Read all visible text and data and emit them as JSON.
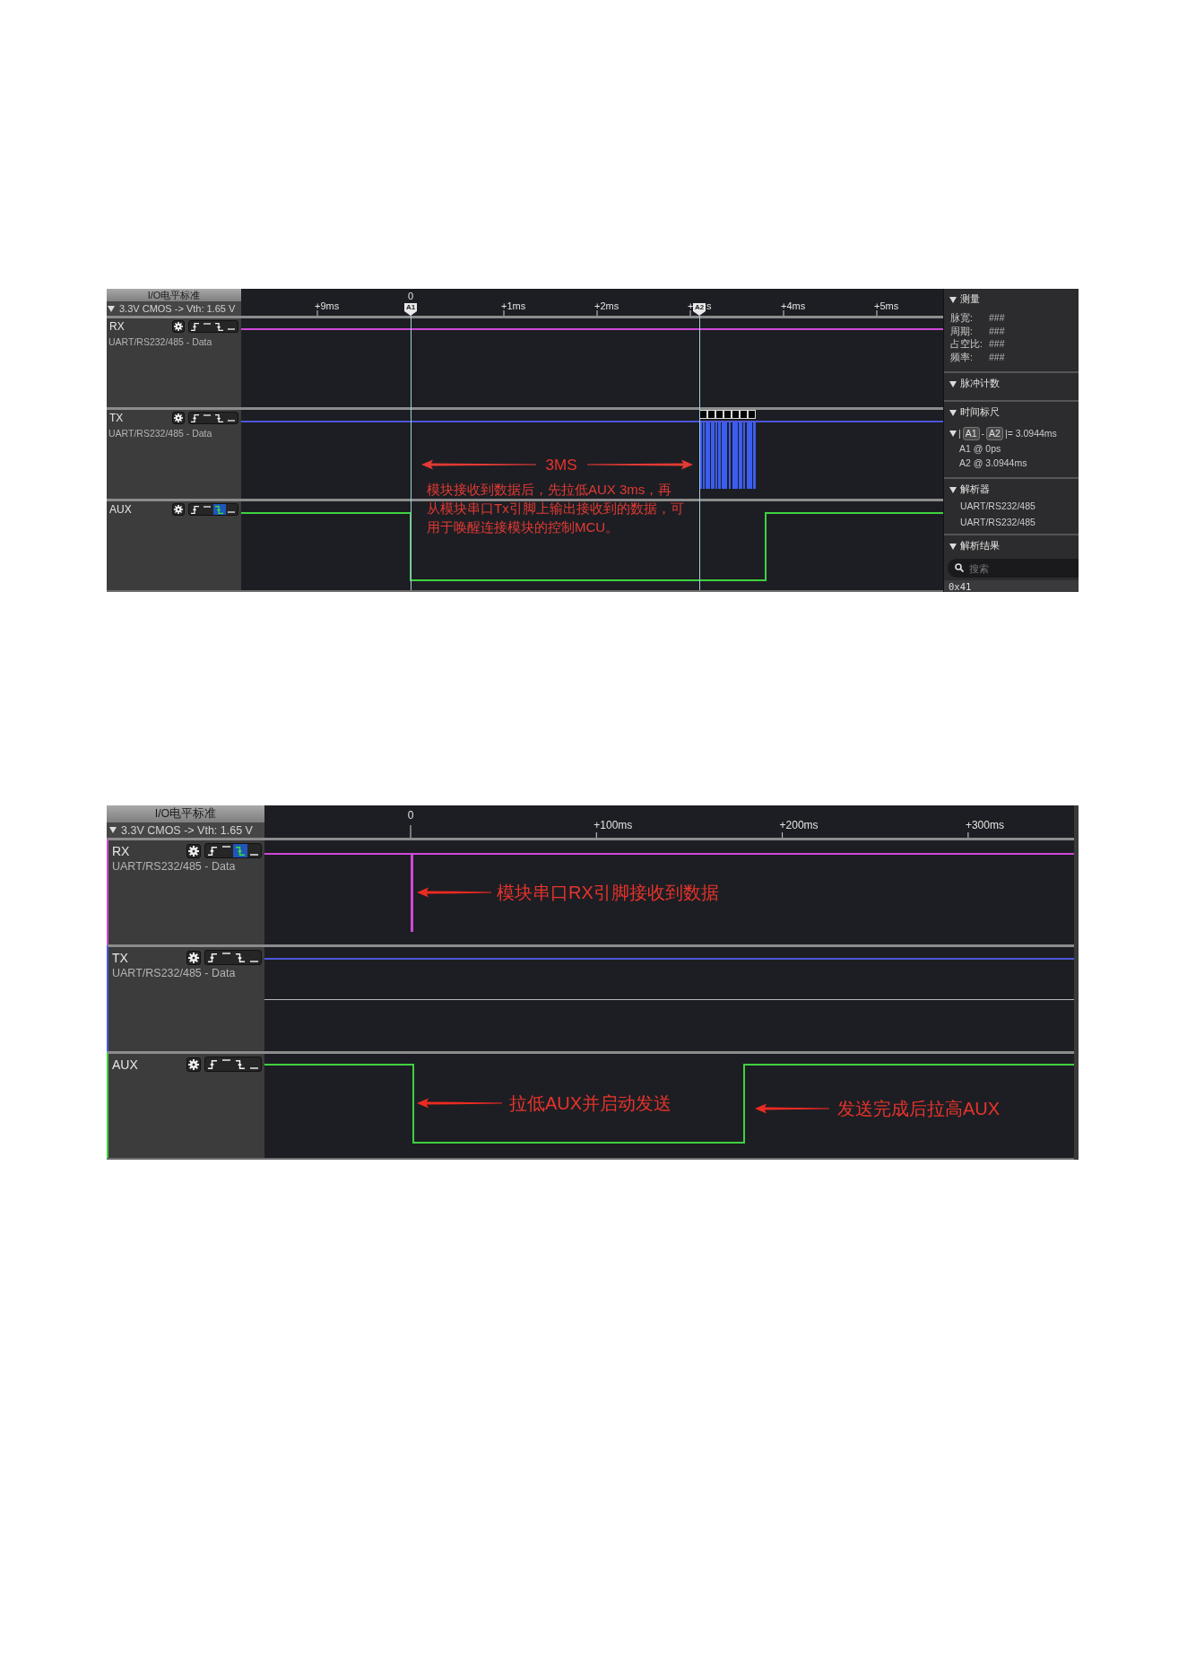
{
  "captures": [
    {
      "level_standard": {
        "title": "I/O电平标准",
        "value": "3.3V CMOS -> Vth: 1.65 V"
      },
      "ruler": {
        "ticks": [
          {
            "kind": "offset",
            "label": "+9ms"
          },
          {
            "kind": "origin",
            "label": "0"
          },
          {
            "kind": "offset",
            "label": "+1ms"
          },
          {
            "kind": "offset",
            "label": "+2ms"
          },
          {
            "kind": "offset",
            "label": "+",
            "tail": "s"
          },
          {
            "kind": "offset",
            "label": "+4ms"
          },
          {
            "kind": "offset",
            "label": "+5ms"
          }
        ]
      },
      "cursors": [
        {
          "label": "A1"
        },
        {
          "label": "A2"
        }
      ],
      "lanes": [
        {
          "name": "RX",
          "protocol": "UART/RS232/485 - Data",
          "color": "#d048d8",
          "triggers": [
            {
              "kind": "rising",
              "selected": false
            },
            {
              "kind": "high",
              "selected": false
            },
            {
              "kind": "falling",
              "selected": false
            },
            {
              "kind": "low",
              "selected": false
            }
          ]
        },
        {
          "name": "TX",
          "protocol": "UART/RS232/485 - Data",
          "color": "#4b57dc",
          "triggers": [
            {
              "kind": "rising",
              "selected": false
            },
            {
              "kind": "high",
              "selected": false
            },
            {
              "kind": "falling",
              "selected": false
            },
            {
              "kind": "low",
              "selected": false
            }
          ]
        },
        {
          "name": "AUX",
          "color": "#3fd13f",
          "triggers": [
            {
              "kind": "rising",
              "selected": false
            },
            {
              "kind": "high",
              "selected": false
            },
            {
              "kind": "falling",
              "selected": true
            },
            {
              "kind": "low",
              "selected": false
            }
          ]
        }
      ],
      "annotations": [
        {
          "kind": "span",
          "text": "3MS"
        },
        {
          "kind": "note",
          "lines": [
            "模块接收到数据后，先拉低AUX 3ms，再",
            "从模块串口Tx引脚上输出接收到的数据，可",
            "用于唤醒连接模块的控制MCU。"
          ]
        }
      ],
      "side_panel": {
        "sections": [
          {
            "kind": "measure",
            "title": "测量",
            "expanded": true,
            "rows": [
              {
                "label": "脉宽:",
                "value": "###"
              },
              {
                "label": "周期:",
                "value": "###"
              },
              {
                "label": "占空比:",
                "value": "###"
              },
              {
                "label": "频率:",
                "value": "###"
              }
            ]
          },
          {
            "kind": "plain",
            "title": "脉冲计数",
            "expanded": true
          },
          {
            "kind": "cursors",
            "title": "时间标尺",
            "expanded": true,
            "delta": {
              "expanded": true,
              "parts": [
                {
                  "kind": "text",
                  "text": "|"
                },
                {
                  "kind": "badge",
                  "text": "A1"
                },
                {
                  "kind": "text",
                  "text": "-"
                },
                {
                  "kind": "badge",
                  "text": "A2"
                },
                {
                  "kind": "text",
                  "text": "|= 3.0944ms"
                }
              ]
            },
            "rows": [
              "A1 @ 0ps",
              "A2 @ 3.0944ms"
            ]
          },
          {
            "kind": "list",
            "title": "解析器",
            "expanded": true,
            "rows": [
              "UART/RS232/485",
              "UART/RS232/485"
            ]
          },
          {
            "kind": "results",
            "title": "解析结果",
            "expanded": true,
            "search": {
              "placeholder": "搜索"
            },
            "rows": [
              "0x41"
            ]
          }
        ]
      }
    },
    {
      "level_standard": {
        "title": "I/O电平标准",
        "value": "3.3V CMOS -> Vth: 1.65 V"
      },
      "ruler": {
        "ticks": [
          {
            "kind": "origin",
            "label": "0"
          },
          {
            "kind": "offset",
            "label": "+100ms"
          },
          {
            "kind": "offset",
            "label": "+200ms"
          },
          {
            "kind": "offset",
            "label": "+300ms"
          }
        ]
      },
      "lanes": [
        {
          "name": "RX",
          "protocol": "UART/RS232/485 - Data",
          "color": "#d048d8",
          "triggers": [
            {
              "kind": "rising",
              "selected": false
            },
            {
              "kind": "high",
              "selected": false
            },
            {
              "kind": "falling",
              "selected": true
            },
            {
              "kind": "low",
              "selected": false
            }
          ]
        },
        {
          "name": "TX",
          "protocol": "UART/RS232/485 - Data",
          "color": "#4b57dc",
          "triggers": [
            {
              "kind": "rising",
              "selected": false
            },
            {
              "kind": "high",
              "selected": false
            },
            {
              "kind": "falling",
              "selected": false
            },
            {
              "kind": "low",
              "selected": false
            }
          ]
        },
        {
          "name": "AUX",
          "color": "#3fd13f",
          "triggers": [
            {
              "kind": "rising",
              "selected": false
            },
            {
              "kind": "high",
              "selected": false
            },
            {
              "kind": "falling",
              "selected": false
            },
            {
              "kind": "low",
              "selected": false
            }
          ]
        }
      ],
      "annotations": [
        {
          "kind": "arrow",
          "text": "模块串口RX引脚接收到数据"
        },
        {
          "kind": "arrow",
          "text": "拉低AUX并启动发送"
        },
        {
          "kind": "arrow",
          "text": "发送完成后拉高AUX"
        }
      ]
    }
  ]
}
